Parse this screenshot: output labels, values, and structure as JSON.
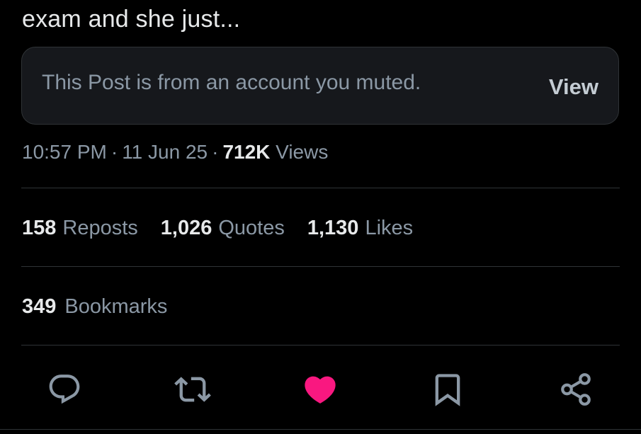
{
  "post": {
    "text": "exam and she just..."
  },
  "muted_notice": {
    "message": "This Post is from an account you muted.",
    "view_label": "View"
  },
  "meta": {
    "time": "10:57 PM",
    "separator": "·",
    "date": "11 Jun 25",
    "views_count": "712K",
    "views_label": "Views"
  },
  "stats": {
    "reposts": {
      "count": "158",
      "label": "Reposts"
    },
    "quotes": {
      "count": "1,026",
      "label": "Quotes"
    },
    "likes": {
      "count": "1,130",
      "label": "Likes"
    },
    "bookmarks": {
      "count": "349",
      "label": "Bookmarks"
    }
  },
  "actions": {
    "icons": [
      "reply-icon",
      "repost-icon",
      "like-icon",
      "bookmark-icon",
      "share-icon"
    ],
    "liked": true
  },
  "colors": {
    "background": "#000000",
    "text_primary": "#e7e9ea",
    "text_secondary": "#8b98a5",
    "card_bg": "#16181c",
    "divider": "#2f3336",
    "like_active": "#f91880",
    "icon_default": "#8b98a5"
  }
}
